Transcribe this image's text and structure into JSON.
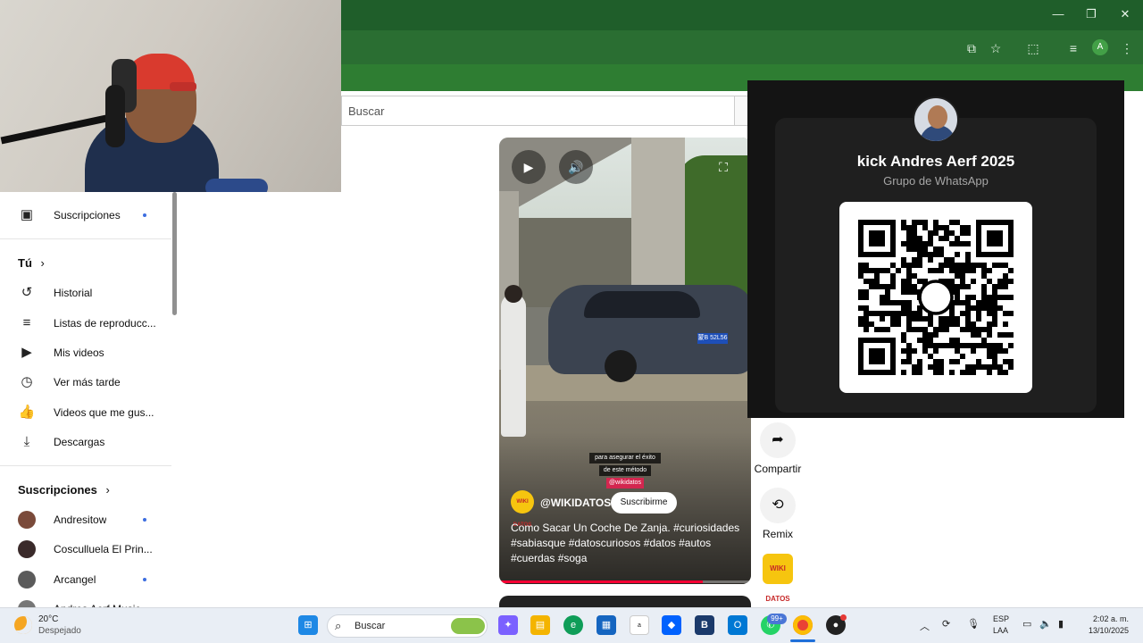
{
  "browser": {
    "window_controls": {
      "minimize": "—",
      "maximize": "❐",
      "close": "✕"
    },
    "toolbar_icons": [
      "cast-icon",
      "star-icon",
      "extensions-icon",
      "media-icon"
    ],
    "profile_initial": "A"
  },
  "search": {
    "placeholder": "Buscar"
  },
  "sidebar": {
    "subscriptions_item": "Suscripciones",
    "you_header": "Tú",
    "you_items": [
      {
        "label": "Historial",
        "icon": "history-icon"
      },
      {
        "label": "Listas de reproducc...",
        "icon": "playlist-icon"
      },
      {
        "label": "Mis videos",
        "icon": "my-videos-icon"
      },
      {
        "label": "Ver más tarde",
        "icon": "watch-later-icon"
      },
      {
        "label": "Videos que me gus...",
        "icon": "like-icon"
      },
      {
        "label": "Descargas",
        "icon": "download-icon"
      }
    ],
    "subs_header": "Suscripciones",
    "channels": [
      {
        "name": "Andresitow",
        "color": "#7a4a3a",
        "new": true
      },
      {
        "name": "Cosculluela El Prin...",
        "color": "#3a2a2a",
        "new": false
      },
      {
        "name": "Arcangel",
        "color": "#5b5b5b",
        "new": true
      },
      {
        "name": "Andres Aerf Music",
        "color": "#777777",
        "new": false
      }
    ]
  },
  "video": {
    "caption_line1": "para asegurar el éxito",
    "caption_line2": "de este método",
    "caption_handle": "@wikidatos",
    "plate": "蒙B 52L56",
    "channel_avatar_text": "WIKI DATOS",
    "channel_name": "@WIKIDATOS",
    "subscribe_label": "Suscribirme",
    "title": "Como Sacar Un Coche De Zanja. #curiosidades #sabiasque #datoscuriosos #datos #autos #cuerdas #soga",
    "progress": 0.81
  },
  "actions": {
    "share_label": "Compartir",
    "remix_label": "Remix",
    "channel_badge": "WIKI DATOS"
  },
  "whatsapp": {
    "group_name": "kick Andres Aerf 2025",
    "group_type": "Grupo de WhatsApp"
  },
  "taskbar": {
    "weather_temp": "20°C",
    "weather_desc": "Despejado",
    "search_placeholder": "Buscar",
    "whatsapp_badge": "99+",
    "lang_line1": "ESP",
    "lang_line2": "LAA",
    "time": "2:02 a. m.",
    "date": "13/10/2025"
  }
}
